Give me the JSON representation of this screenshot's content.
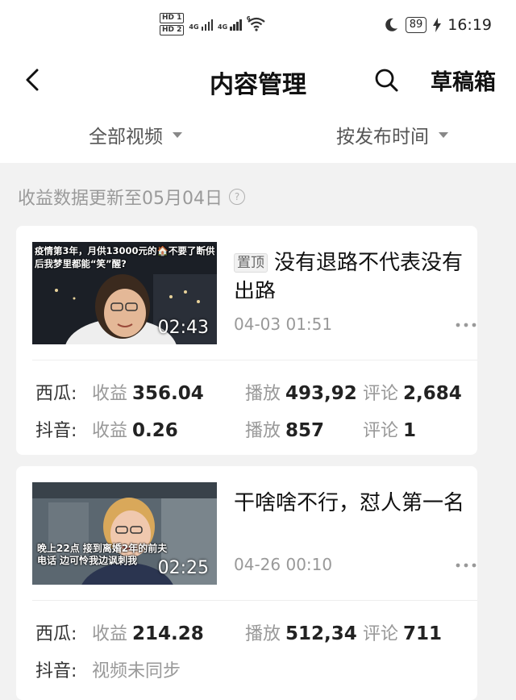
{
  "status_bar": {
    "hd1": "HD 1",
    "hd2": "HD 2",
    "net1": "4G",
    "net2": "4G",
    "wifi_label": "6",
    "battery": "89",
    "time": "16:19"
  },
  "nav": {
    "title": "内容管理",
    "drafts": "草稿箱"
  },
  "filters": {
    "video_filter": "全部视频",
    "sort_filter": "按发布时间"
  },
  "notice": {
    "text": "收益数据更新至05月04日",
    "help": "?"
  },
  "videos": [
    {
      "pinned_tag": "置顶",
      "title": "没有退路不代表没有出路",
      "duration": "02:43",
      "published": "04-03 01:51",
      "thumb_caption": "疫情第3年，月供13000元的🏠不要了断供后我梦里都能“笑”醒?",
      "xigua": {
        "platform": "西瓜:",
        "income_label": "收益",
        "income": "356.04",
        "plays_label": "播放",
        "plays": "493,92",
        "comments_label": "评论",
        "comments": "2,684"
      },
      "douyin": {
        "platform": "抖音:",
        "income_label": "收益",
        "income": "0.26",
        "plays_label": "播放",
        "plays": "857",
        "comments_label": "评论",
        "comments": "1"
      }
    },
    {
      "title": "干啥啥不行，怼人第一名",
      "duration": "02:25",
      "published": "04-26 00:10",
      "thumb_caption": "晚上22点 接到离婚2年的前夫电话 边可怜我边讽刺我",
      "xigua": {
        "platform": "西瓜:",
        "income_label": "收益",
        "income": "214.28",
        "plays_label": "播放",
        "plays": "512,34",
        "comments_label": "评论",
        "comments": "711"
      },
      "douyin": {
        "platform": "抖音:",
        "status": "视频未同步"
      }
    }
  ],
  "colors": {
    "background": "#f2f2f2",
    "card": "#ffffff",
    "muted_text": "#999999",
    "primary_text": "#222222"
  }
}
